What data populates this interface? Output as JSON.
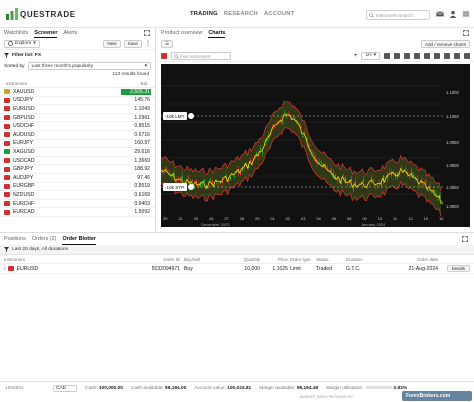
{
  "brand": {
    "name": "QUESTRADE"
  },
  "nav": {
    "items": [
      "TRADING",
      "RESEARCH",
      "ACCOUNT"
    ],
    "active": 0
  },
  "top_search": {
    "placeholder": "Instrument search"
  },
  "left_panel": {
    "tabs": [
      "Watchlists",
      "Screener",
      "Alerts"
    ],
    "active_tab": 1,
    "explore_label": "Explore",
    "new_label": "New",
    "save_label": "Save",
    "filter_label": "Filter list: FX",
    "sorted_by_label": "Sorted by",
    "sort_value": "Last three month's popularity",
    "results": "113 results found",
    "col_instrument": "Instrument",
    "col_bid": "Bid",
    "rows": [
      {
        "sym": "XAUUSD",
        "bid": "2,505.31",
        "flag": "#c9a227",
        "up": true
      },
      {
        "sym": "USDJPY",
        "bid": "145.76",
        "flag": "#d32f2f",
        "up": false
      },
      {
        "sym": "EURUSD",
        "bid": "1.1043",
        "flag": "#d32f2f",
        "up": false
      },
      {
        "sym": "GBPUSD",
        "bid": "1.2961",
        "flag": "#d32f2f",
        "up": false
      },
      {
        "sym": "USDCHF",
        "bid": "0.8515",
        "flag": "#d32f2f",
        "up": false
      },
      {
        "sym": "AUDUSD",
        "bid": "0.6716",
        "flag": "#d32f2f",
        "up": false
      },
      {
        "sym": "EURJPY",
        "bid": "160.97",
        "flag": "#d32f2f",
        "up": false
      },
      {
        "sym": "XAGUSD",
        "bid": "29.616",
        "flag": "#1f9d3a",
        "up": false
      },
      {
        "sym": "USDCAD",
        "bid": "1.3669",
        "flag": "#d32f2f",
        "up": false
      },
      {
        "sym": "GBPJPY",
        "bid": "188.92",
        "flag": "#d32f2f",
        "up": false
      },
      {
        "sym": "AUDJPY",
        "bid": "97.46",
        "flag": "#d32f2f",
        "up": false
      },
      {
        "sym": "EURGBP",
        "bid": "0.8519",
        "flag": "#d32f2f",
        "up": false
      },
      {
        "sym": "NZDUSD",
        "bid": "0.6169",
        "flag": "#d32f2f",
        "up": false
      },
      {
        "sym": "EURCHF",
        "bid": "0.9403",
        "flag": "#d32f2f",
        "up": false
      },
      {
        "sym": "EURCAD",
        "bid": "1.5092",
        "flag": "#d32f2f",
        "up": false
      }
    ]
  },
  "right_panel": {
    "tabs": [
      "Product overview",
      "Charts"
    ],
    "active_tab": 1,
    "add_remove_label": "Add / remove charts",
    "find_placeholder": "Find instrument",
    "timeframe": "1H",
    "order_labels": [
      "-10k LMT",
      "-10k STP"
    ],
    "price_labels": [
      "1.1000",
      "1.1050",
      "1.0950",
      "1.0900",
      "1.0850",
      "1.0800"
    ],
    "date_labels": [
      "20",
      "21",
      "25",
      "26",
      "27",
      "28",
      "29",
      "01",
      "02",
      "03",
      "04",
      "05",
      "08",
      "09",
      "10",
      "11",
      "12",
      "15",
      "16"
    ],
    "month_labels": [
      "December 2023",
      "January 2024"
    ]
  },
  "bottom": {
    "tabs": [
      "Positions",
      "Orders (2)",
      "Order Blotter"
    ],
    "active_tab": 2,
    "filter_text": "Last 28 days, All durations",
    "columns": [
      "Instrument",
      "Order ID",
      "Buy/Sell",
      "Quantity",
      "Price",
      "Order type",
      "Status",
      "Duration",
      "Order date"
    ],
    "rows": [
      {
        "instrument": "EURUSD",
        "order_id": "5032094971",
        "side": "Buy",
        "qty": "10,000",
        "price": "1.1025",
        "type": "Limit",
        "status": "Traded",
        "duration": "G.T.C.",
        "date": "21-Aug-2024",
        "action": "Details"
      }
    ]
  },
  "footer": {
    "account": "1960804",
    "currency": "CAD",
    "cash_label": "Cash:",
    "cash": "100,000.00",
    "cash_avail_label": "Cash available:",
    "cash_avail": "99,194.00",
    "acct_value_label": "Account value:",
    "acct_value": "100,024.81",
    "margin_avail_label": "Margin available:",
    "margin_avail": "99,194.49",
    "margin_util_label": "Margin utilisation:",
    "margin_util": "0.83%",
    "footnote": "MARKET DATA PROVIDED BY",
    "watermark": "ForexBrokers.com"
  }
}
